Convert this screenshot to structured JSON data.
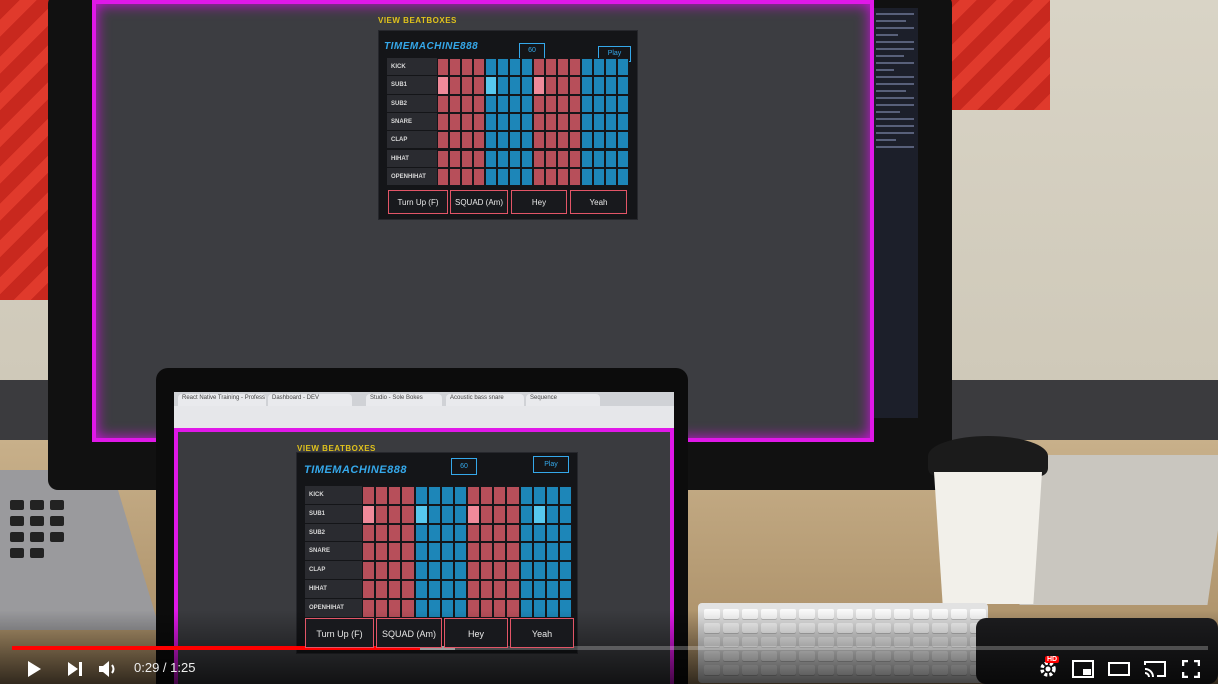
{
  "video": {
    "current_time": "0:29",
    "separator": " / ",
    "duration": "1:25",
    "played_fraction": 0.341,
    "loaded_fraction": 0.37,
    "hd_badge": "HD",
    "accent": "#ff0000",
    "icons": [
      "play-icon",
      "next-icon",
      "volume-icon",
      "settings-icon",
      "miniplayer-icon",
      "theater-icon",
      "cast-icon",
      "fullscreen-icon"
    ]
  },
  "app": {
    "view_link": "VIEW BEATBOXES",
    "machine_name": "TIMEMACHINE888",
    "bpm": "60",
    "play_label": "Play",
    "tracks": [
      "KICK",
      "SUB1",
      "SUB2",
      "SNARE",
      "CLAP",
      "HIHAT",
      "OPENHIHAT"
    ],
    "presets": [
      "Turn Up (F)",
      "SQUAD (Am)",
      "Hey",
      "Yeah"
    ],
    "steps": 16,
    "colors": {
      "red_pad": "#b74f5a",
      "blue_pad": "#1d86b8",
      "title": "#35a8ea",
      "border_glow": "#e018e8"
    }
  },
  "monitor_pattern": {
    "active": [
      [
        1,
        0
      ],
      [
        1,
        4
      ],
      [
        1,
        8
      ]
    ]
  },
  "laptop_pattern": {
    "active": [
      [
        1,
        0
      ],
      [
        1,
        4
      ],
      [
        1,
        8
      ],
      [
        1,
        13
      ]
    ]
  },
  "laptop_browser": {
    "tabs": [
      "React Native Training - Profess",
      "Dashboard - DEV",
      "Studio - Sole Bokes",
      "Acoustic bass snare",
      "Sequence"
    ]
  }
}
